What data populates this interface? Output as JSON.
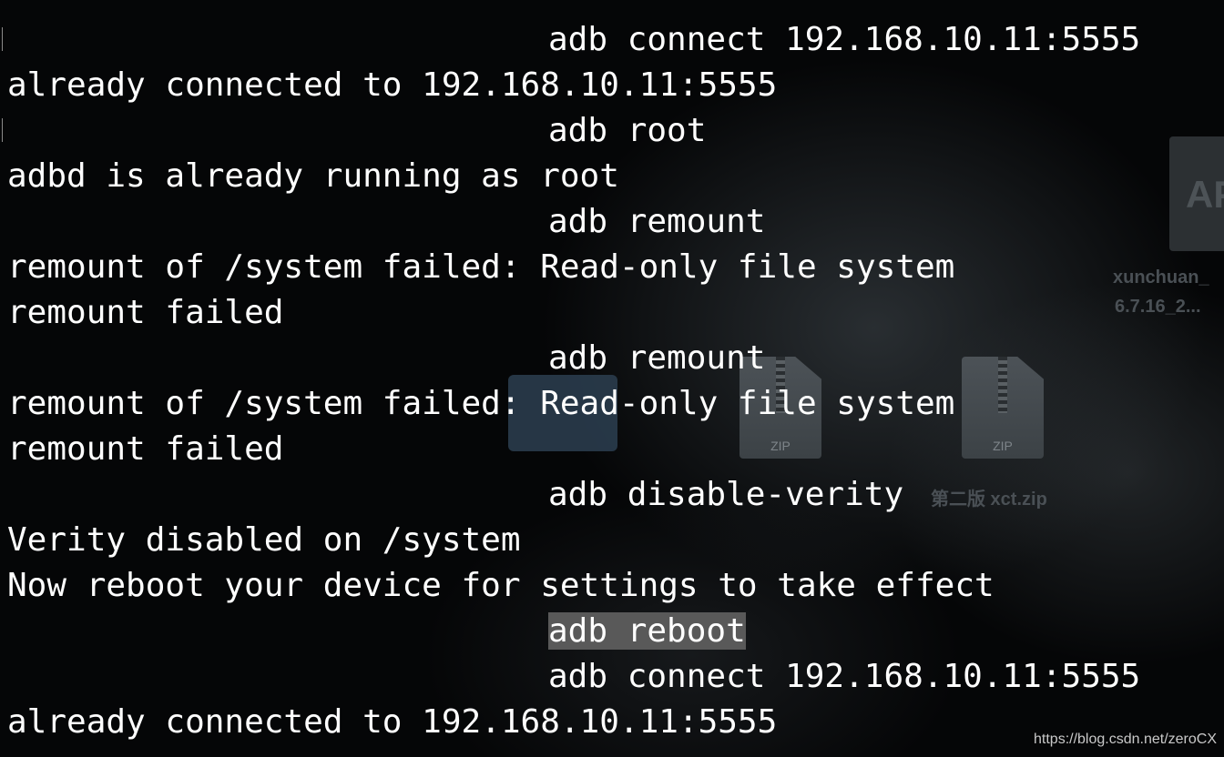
{
  "desktop": {
    "apk_badge": "AP",
    "apk_name_line1": "xunchuan_",
    "apk_name_line2": "6.7.16_2...",
    "zip_ext": "ZIP",
    "zip_ext_2": "ZIP",
    "zip_name": "第二版 xct.zip"
  },
  "terminal": {
    "lines": [
      {
        "type": "cmd",
        "text": "adb connect 192.168.10.11:5555"
      },
      {
        "type": "out",
        "text": "already connected to 192.168.10.11:5555"
      },
      {
        "type": "cmd",
        "text": "adb root"
      },
      {
        "type": "out",
        "text": "adbd is already running as root"
      },
      {
        "type": "cmd",
        "text": "adb remount"
      },
      {
        "type": "out",
        "text": "remount of /system failed: Read-only file system"
      },
      {
        "type": "out",
        "text": "remount failed"
      },
      {
        "type": "cmd",
        "text": "adb remount"
      },
      {
        "type": "out",
        "text": "remount of /system failed: Read-only file system"
      },
      {
        "type": "out",
        "text": "remount failed"
      },
      {
        "type": "cmd",
        "text": "adb disable-verity"
      },
      {
        "type": "out",
        "text": "Verity disabled on /system"
      },
      {
        "type": "out",
        "text": "Now reboot your device for settings to take effect"
      },
      {
        "type": "cmd",
        "text": "adb reboot",
        "selected": true
      },
      {
        "type": "cmd",
        "text": "adb connect 192.168.10.11:5555"
      },
      {
        "type": "out",
        "text": "already connected to 192.168.10.11:5555"
      }
    ]
  },
  "watermark": "https://blog.csdn.net/zeroCX",
  "colors": {
    "background": "#050607",
    "text": "#ffffff",
    "selection": "#595959"
  }
}
